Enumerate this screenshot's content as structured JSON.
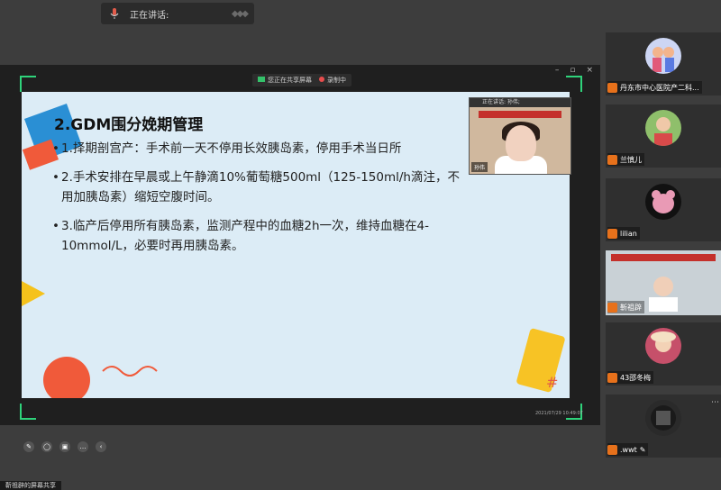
{
  "top_indicator": {
    "label": "正在讲话:"
  },
  "share_window": {
    "controls": [
      "–",
      "▫",
      "×"
    ],
    "banner": {
      "sharing_label": "您正在共享屏幕",
      "record_label": "录制中"
    }
  },
  "slide": {
    "title": "2.GDM围分娩期管理",
    "bullets": [
      "1.择期剖宫产：手术前一天不停用长效胰岛素，停用手术当日所",
      "2.手术安排在早晨或上午静滴10%葡萄糖500ml（125-150ml/h滴注，不",
      "用加胰岛素）缩短空腹时间。",
      "3.临产后停用所有胰岛素，监测产程中的血糖2h一次，维持血糖在4-",
      "10mmol/L，必要时再用胰岛素。"
    ],
    "timestamp": "2021/07/29 10:49:07"
  },
  "pip_video": {
    "header": "正在讲话: 孙伟;",
    "name": "孙伟"
  },
  "participants": [
    {
      "name": "丹东市中心医院产二科..."
    },
    {
      "name": "兰慎儿"
    },
    {
      "name": "lilian"
    },
    {
      "name": "靳祖辟"
    },
    {
      "name": "43邵冬梅"
    },
    {
      "name": ".wwt"
    }
  ],
  "bottom_label": "靳祖辟的屏幕共享"
}
